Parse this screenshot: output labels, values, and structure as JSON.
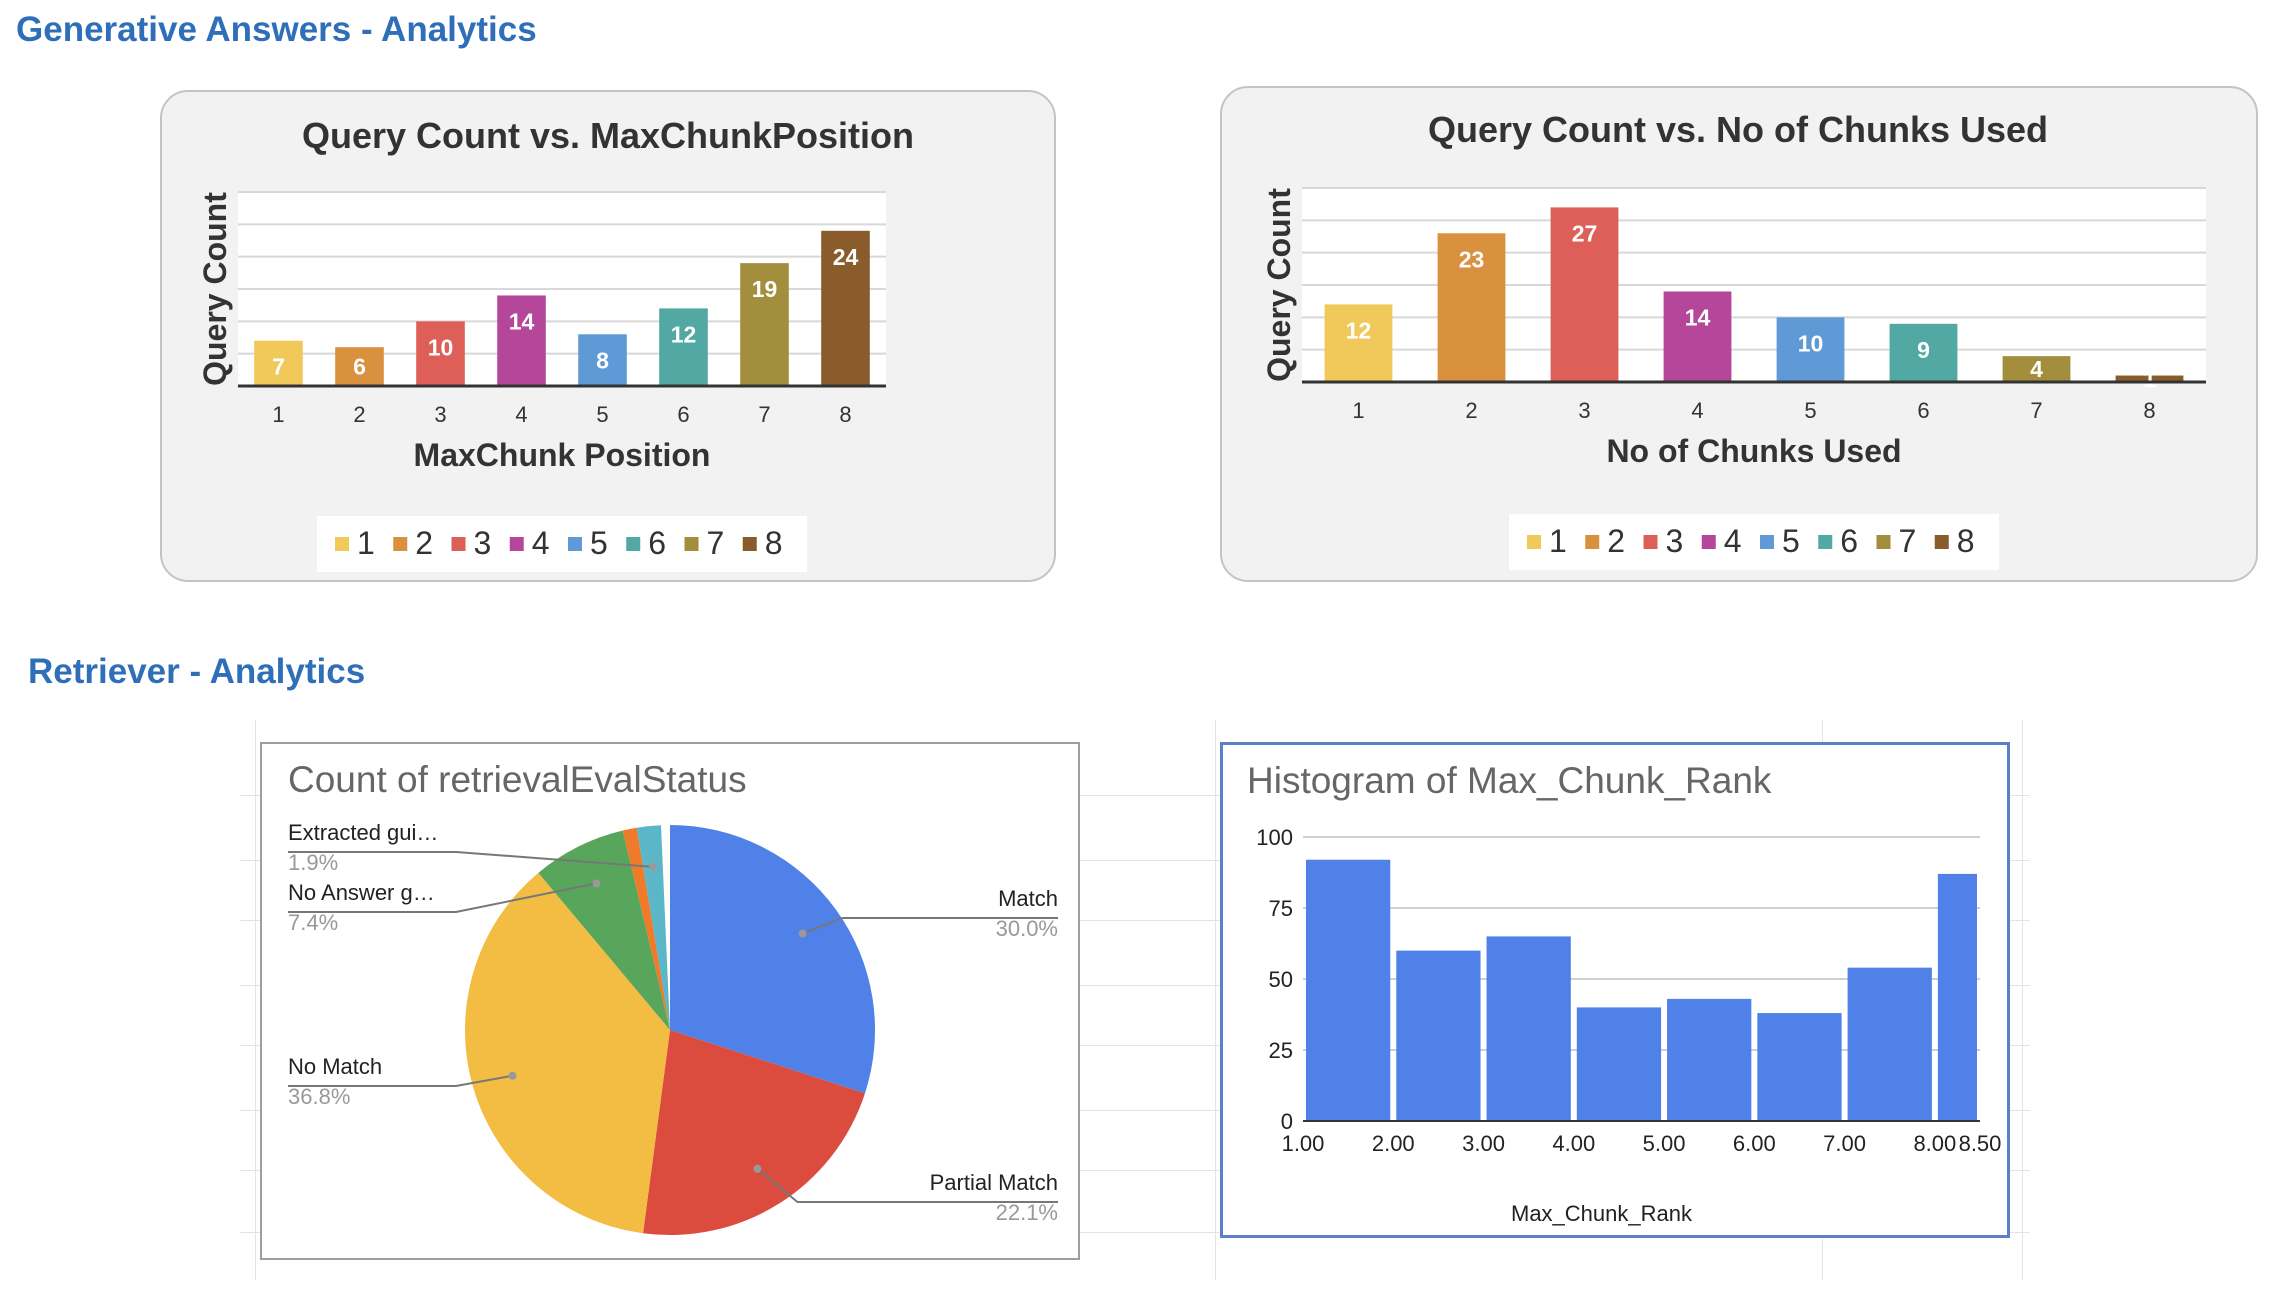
{
  "sections": {
    "generative_title": "Generative Answers - Analytics",
    "retriever_title": "Retriever - Analytics"
  },
  "chart_data": [
    {
      "type": "bar",
      "title": "Query Count vs. MaxChunkPosition",
      "xlabel": "MaxChunk Position",
      "ylabel": "Query Count",
      "categories": [
        "1",
        "2",
        "3",
        "4",
        "5",
        "6",
        "7",
        "8"
      ],
      "values": [
        7,
        6,
        10,
        14,
        8,
        12,
        19,
        24
      ],
      "colors": [
        "#f0c95a",
        "#d9903f",
        "#dd5f58",
        "#b5479a",
        "#5f9ad6",
        "#52a8a3",
        "#a28e3c",
        "#8a5c2c"
      ],
      "legend": [
        "1",
        "2",
        "3",
        "4",
        "5",
        "6",
        "7",
        "8"
      ],
      "legend_position": "bottom",
      "ylim": [
        0,
        30
      ],
      "grid": true
    },
    {
      "type": "bar",
      "title": "Query Count vs. No of Chunks Used",
      "xlabel": "No of Chunks Used",
      "ylabel": "Query Count",
      "categories": [
        "1",
        "2",
        "3",
        "4",
        "5",
        "6",
        "7",
        "8"
      ],
      "values": [
        12,
        23,
        27,
        14,
        10,
        9,
        4,
        1
      ],
      "colors": [
        "#f0c95a",
        "#d9903f",
        "#dd5f58",
        "#b5479a",
        "#5f9ad6",
        "#52a8a3",
        "#a28e3c",
        "#8a5c2c"
      ],
      "legend": [
        "1",
        "2",
        "3",
        "4",
        "5",
        "6",
        "7",
        "8"
      ],
      "legend_position": "bottom",
      "ylim": [
        0,
        30
      ],
      "grid": true
    },
    {
      "type": "pie",
      "title": "Count of retrievalEvalStatus",
      "slices": [
        {
          "label": "Match",
          "percent": 30.0,
          "percent_label": "30.0%",
          "color": "#4f81e8"
        },
        {
          "label": "Partial Match",
          "percent": 22.1,
          "percent_label": "22.1%",
          "color": "#db4c3f"
        },
        {
          "label": "No Match",
          "percent": 36.8,
          "percent_label": "36.8%",
          "color": "#f2bd42"
        },
        {
          "label": "No Answer g…",
          "percent": 7.4,
          "percent_label": "7.4%",
          "color": "#58a65c"
        },
        {
          "label": "",
          "percent": 1.1,
          "percent_label": "",
          "color": "#ee7a2a"
        },
        {
          "label": "Extracted gui…",
          "percent": 1.9,
          "percent_label": "1.9%",
          "color": "#5bb7c7"
        }
      ]
    },
    {
      "type": "bar",
      "title": "Histogram of Max_Chunk_Rank",
      "xlabel": "Max_Chunk_Rank",
      "ylabel": "",
      "bins": [
        [
          1.0,
          2.0
        ],
        [
          2.0,
          3.0
        ],
        [
          3.0,
          4.0
        ],
        [
          4.0,
          5.0
        ],
        [
          5.0,
          6.0
        ],
        [
          6.0,
          7.0
        ],
        [
          7.0,
          8.0
        ],
        [
          8.0,
          8.5
        ]
      ],
      "values": [
        92,
        60,
        65,
        40,
        43,
        38,
        54,
        87
      ],
      "xticks": [
        "1.00",
        "2.00",
        "3.00",
        "4.00",
        "5.00",
        "6.00",
        "7.00",
        "8.00",
        "8.50"
      ],
      "yticks": [
        "0",
        "25",
        "50",
        "75",
        "100"
      ],
      "ylim": [
        0,
        100
      ],
      "color": "#4f81e8",
      "grid": true
    }
  ]
}
